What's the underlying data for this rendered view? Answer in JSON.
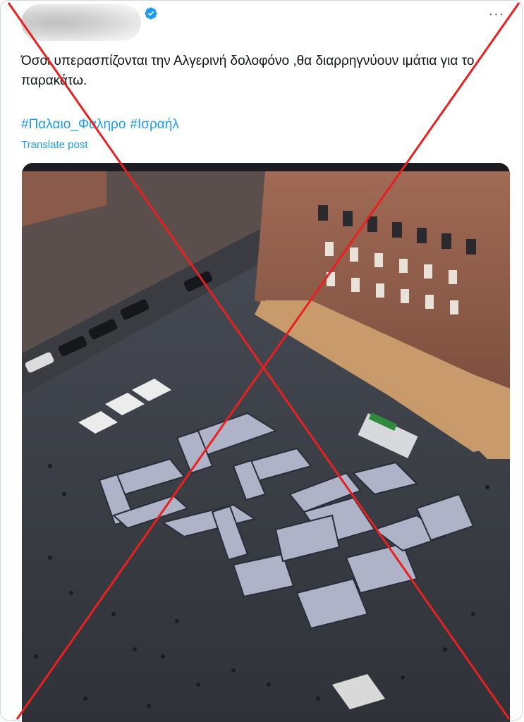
{
  "post": {
    "text": "Όσοι υπερασπίζονται την Αλγερινή δολοφόνο ,θα διαρρηγνύουν ιμάτια για το παρακάτω.",
    "hashtags": [
      "#Παλαιο_Φαληρο",
      "#Ισραήλ"
    ],
    "translate_label": "Translate post",
    "more_label": "···"
  },
  "icons": {
    "verified": "verified-badge-icon",
    "more": "more-options-icon",
    "cross": "red-x-cross-overlay"
  },
  "colors": {
    "link": "#1d9bf0",
    "text": "#0f1419",
    "cross": "#e8201f",
    "verified": "#1d9bf0"
  }
}
